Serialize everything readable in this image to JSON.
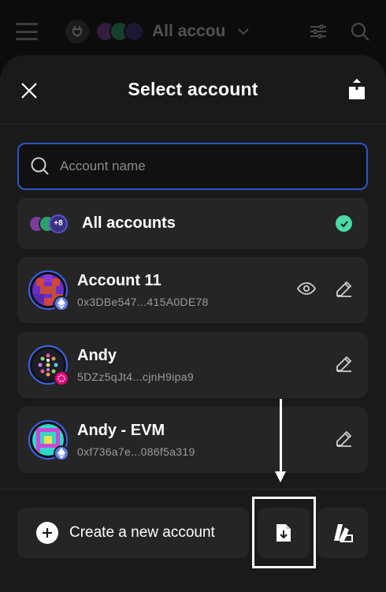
{
  "header": {
    "title": "All accou",
    "icons": [
      "menu-icon",
      "plug-icon",
      "chevron-down-icon",
      "filter-icon",
      "search-icon"
    ]
  },
  "modal": {
    "title": "Select account",
    "search_placeholder": "Account name",
    "all_accounts": {
      "label": "All accounts",
      "badge": "+8"
    },
    "accounts": [
      {
        "name": "Account 11",
        "address": "0x3DBe547...415A0DE78",
        "chain": "ethereum",
        "show_eye": true
      },
      {
        "name": "Andy",
        "address": "5DZz5qJt4...cjnH9ipa9",
        "chain": "polkadot",
        "show_eye": false
      },
      {
        "name": "Andy - EVM",
        "address": "0xf736a7e...086f5a319",
        "chain": "ethereum",
        "show_eye": false
      }
    ]
  },
  "footer": {
    "create_label": "Create a new account"
  },
  "colors": {
    "accent_blue": "#3a66f0",
    "check_green": "#4cd9a5",
    "polkadot_pink": "#e6007a",
    "eth_blue": "#627eea"
  }
}
